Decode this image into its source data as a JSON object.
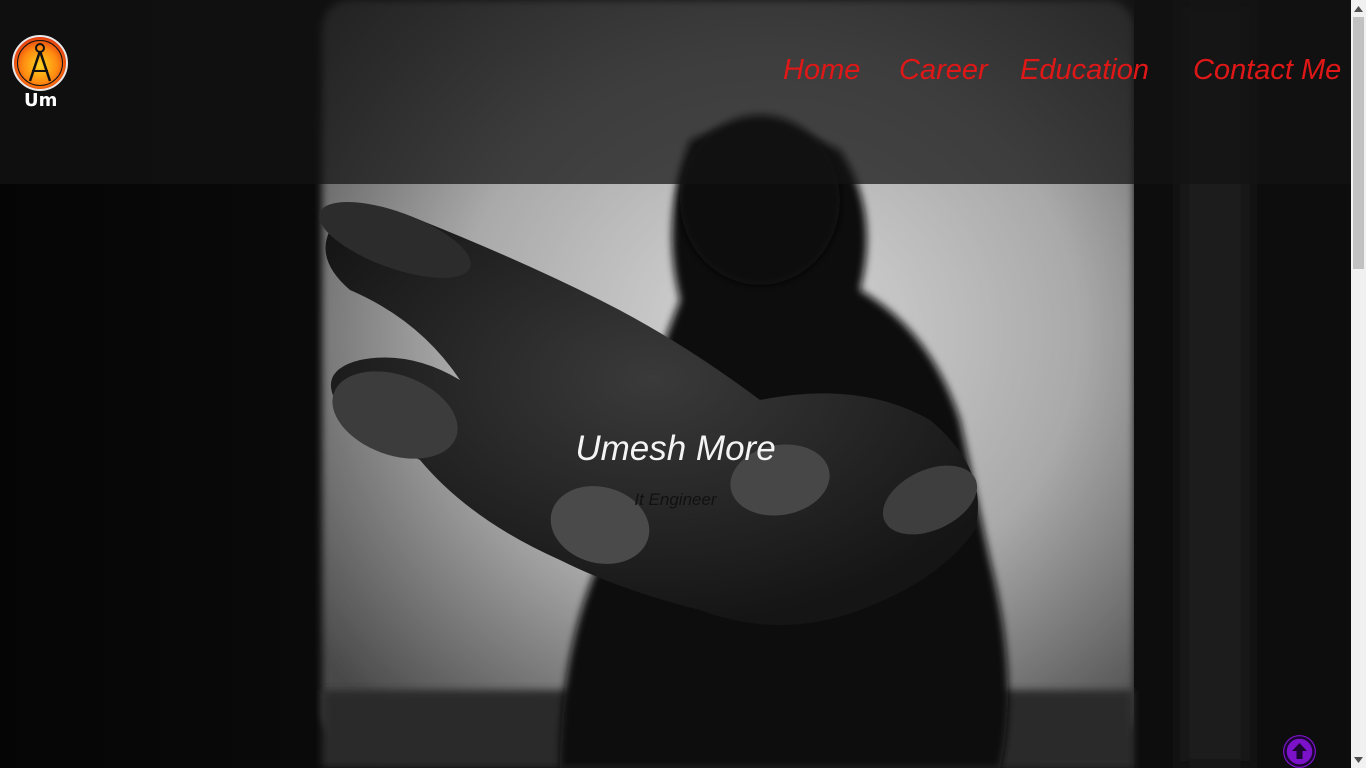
{
  "logo": {
    "text": "Um",
    "icon": "compass-logo-icon"
  },
  "nav": {
    "items": [
      {
        "label": "Home"
      },
      {
        "label": "Career"
      },
      {
        "label": "Education"
      },
      {
        "label": "Contact Me"
      }
    ]
  },
  "hero": {
    "title": "Umesh More",
    "subtitle": "It Engineer"
  },
  "back_to_top": {
    "icon": "arrow-up-circle-icon"
  },
  "colors": {
    "nav_link": "#e01717",
    "back_to_top": "#7b12c9",
    "header_overlay": "rgba(20,20,20,0.72)"
  }
}
